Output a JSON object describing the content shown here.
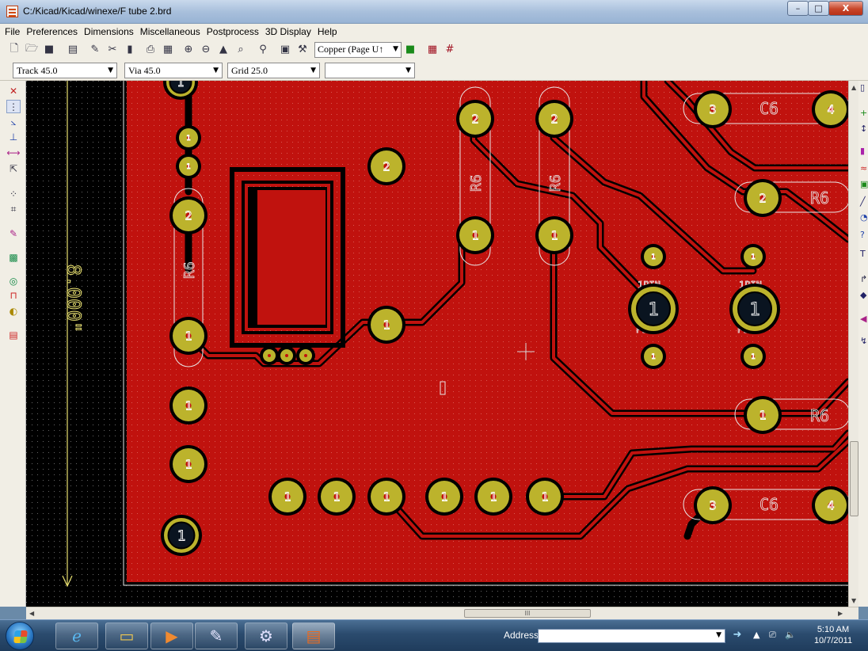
{
  "window": {
    "title": "C:/Kicad/Kicad/winexe/F tube 2.brd",
    "minimize": "–",
    "maximize": "□",
    "close": "X"
  },
  "menu": [
    "File",
    "Preferences",
    "Dimensions",
    "Miscellaneous",
    "Postprocess",
    "3D Display",
    "Help"
  ],
  "toolbar": {
    "layer_select": "Copper (Page U↑"
  },
  "options": {
    "track": "Track 45.0",
    "via": "Via 45.0",
    "grid": "Grid 25.0",
    "extra": ""
  },
  "board": {
    "dimension_text": "8.000\"",
    "labels": {
      "r6": "R6",
      "c6": "C6",
      "onepin": "1PIN",
      "pin": "P1**"
    },
    "pad_numbers": {
      "one": "1",
      "two": "2",
      "three": "3",
      "four": "4"
    }
  },
  "colors": {
    "copper": "#c0120e",
    "pad": "#bcb32c",
    "silk": "#e8e8e8",
    "background": "#000000",
    "dimension": "#e8e070"
  },
  "taskbar": {
    "address_label": "Address",
    "address_value": "",
    "time": "5:10 AM",
    "date": "10/7/2011"
  },
  "scroll": {
    "h_thumb_label": "III"
  }
}
